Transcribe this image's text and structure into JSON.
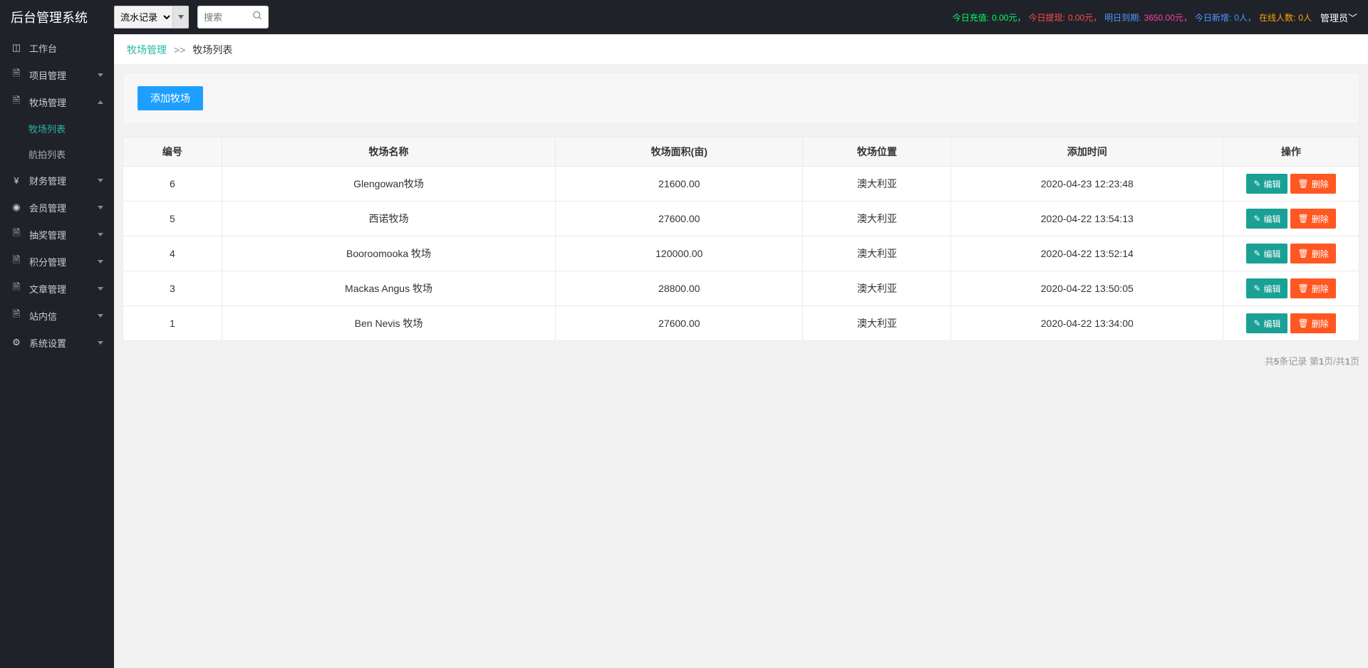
{
  "header": {
    "logo": "后台管理系统",
    "select_option": "流水记录",
    "search_placeholder": "搜索",
    "stats": {
      "recharge_label": "今日充值:",
      "recharge_value": "0.00元，",
      "withdraw_label": "今日提现:",
      "withdraw_value": "0.00元，",
      "expire_label": "明日到期:",
      "expire_value": "3650.00元，",
      "new_label": "今日新增:",
      "new_value": "0人，",
      "online_label": "在线人数:",
      "online_value": "0人"
    },
    "admin_label": "管理员"
  },
  "sidebar": {
    "workbench": "工作台",
    "project": "项目管理",
    "ranch": "牧场管理",
    "ranch_list": "牧场列表",
    "aerial_list": "航拍列表",
    "finance": "财务管理",
    "member": "会员管理",
    "lottery": "抽奖管理",
    "points": "积分管理",
    "article": "文章管理",
    "mail": "站内信",
    "settings": "系统设置"
  },
  "breadcrumb": {
    "a": "牧场管理",
    "sep": ">>",
    "b": "牧场列表"
  },
  "toolbar": {
    "add_label": "添加牧场"
  },
  "table": {
    "headers": {
      "id": "编号",
      "name": "牧场名称",
      "area": "牧场面积(亩)",
      "location": "牧场位置",
      "time": "添加时间",
      "ops": "操作"
    },
    "rows": [
      {
        "id": "6",
        "name": "Glengowan牧场",
        "area": "21600.00",
        "location": "澳大利亚",
        "time": "2020-04-23 12:23:48"
      },
      {
        "id": "5",
        "name": "西诺牧场",
        "area": "27600.00",
        "location": "澳大利亚",
        "time": "2020-04-22 13:54:13"
      },
      {
        "id": "4",
        "name": "Booroomooka 牧场",
        "area": "120000.00",
        "location": "澳大利亚",
        "time": "2020-04-22 13:52:14"
      },
      {
        "id": "3",
        "name": "Mackas Angus 牧场",
        "area": "28800.00",
        "location": "澳大利亚",
        "time": "2020-04-22 13:50:05"
      },
      {
        "id": "1",
        "name": "Ben Nevis 牧场",
        "area": "27600.00",
        "location": "澳大利亚",
        "time": "2020-04-22 13:34:00"
      }
    ],
    "edit_label": "编辑",
    "delete_label": "删除"
  },
  "pager": {
    "total": "5",
    "page": "1",
    "total_pages": "1"
  }
}
